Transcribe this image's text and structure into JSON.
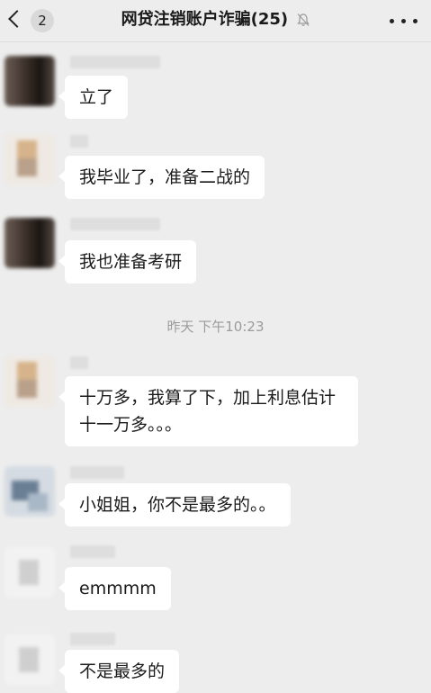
{
  "header": {
    "back_badge": "2",
    "title": "网贷注销账户诈骗(25)",
    "mute_icon": "bell-muted-icon",
    "more_icon": "more-dots-icon"
  },
  "timestamp": "昨天 下午10:23",
  "messages": [
    {
      "text": "立了"
    },
    {
      "text": "我毕业了，准备二战的"
    },
    {
      "text": "我也准备考研"
    },
    {
      "text": "十万多，我算了下，加上利息估计十一万多。。。"
    },
    {
      "text": "小姐姐，你不是最多的。。"
    },
    {
      "text": "emmmm"
    },
    {
      "text": "不是最多的"
    }
  ]
}
